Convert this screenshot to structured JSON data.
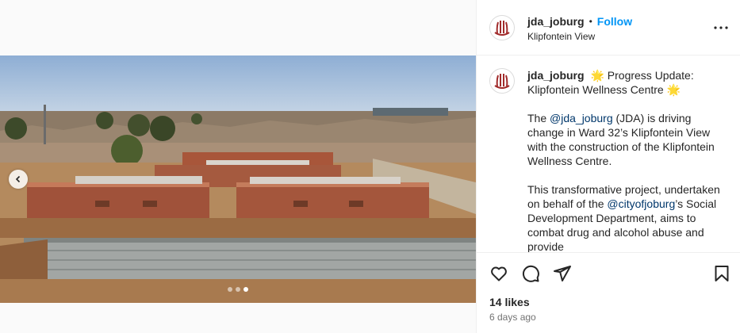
{
  "post": {
    "username": "jda_joburg",
    "separator": "•",
    "follow_label": "Follow",
    "location": "Klipfontein View",
    "more_icon": "more-horizontal-icon",
    "media": {
      "carousel_dots": 3,
      "active_dot": 3,
      "prev_icon": "chevron-left-icon"
    },
    "caption": {
      "username": "jda_joburg",
      "line1_emoji": "🌟",
      "line1_text": "Progress Update: Klipfontein Wellness Centre",
      "line1_end_emoji": "🌟",
      "para2_pre": "The ",
      "para2_mention": "@jda_joburg",
      "para2_post": " (JDA) is driving change in Ward 32’s Klipfontein View with the construction of the Klipfontein Wellness Centre.",
      "para3_pre": "This transformative project, undertaken on behalf of the ",
      "para3_mention": "@cityofjoburg",
      "para3_post": "’s Social Development Department, aims to combat drug and alcohol abuse and provide"
    },
    "likes_text": "14 likes",
    "time_text": "6 days ago",
    "colors": {
      "accent": "#0095f6",
      "mention": "#00376b",
      "text": "#262626",
      "muted": "#737373"
    }
  }
}
